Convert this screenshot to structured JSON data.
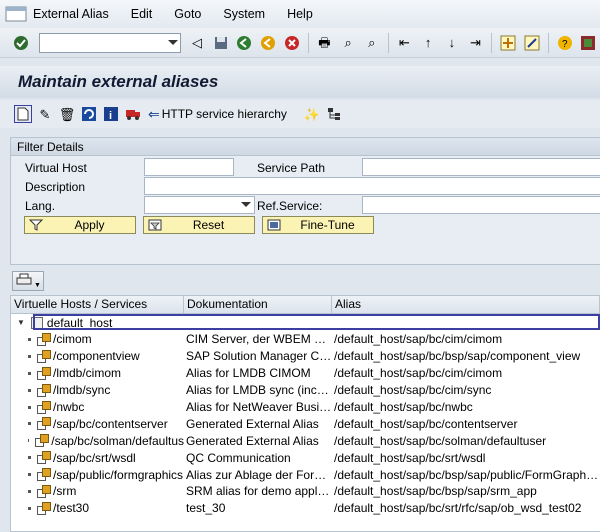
{
  "menu": {
    "items": [
      {
        "label": "External Alias"
      },
      {
        "label": "Edit"
      },
      {
        "label": "Goto"
      },
      {
        "label": "System"
      },
      {
        "label": "Help"
      }
    ]
  },
  "toolbar": {
    "command_value": ""
  },
  "page": {
    "title": "Maintain external aliases"
  },
  "app_toolbar": {
    "http_label": "HTTP service hierarchy"
  },
  "filter": {
    "title": "Filter Details",
    "virtual_host_label": "Virtual Host",
    "service_path_label": "Service Path",
    "description_label": "Description",
    "lang_label": "Lang.",
    "ref_service_label": "Ref.Service:",
    "apply_label": "Apply",
    "reset_label": "Reset",
    "fine_tune_label": "Fine-Tune"
  },
  "tree": {
    "headers": [
      "Virtuelle Hosts / Services",
      "Dokumentation",
      "Alias"
    ],
    "root": "default_host",
    "rows": [
      {
        "service": "/cimom",
        "doc": "CIM Server, der WBEM Re...",
        "alias": "/default_host/sap/bc/cim/cimom"
      },
      {
        "service": "/componentview",
        "doc": "SAP Solution Manager Co...",
        "alias": "/default_host/sap/bc/bsp/sap/component_view"
      },
      {
        "service": "/lmdb/cimom",
        "doc": "Alias for LMDB CIMOM",
        "alias": "/default_host/sap/bc/cim/cimom"
      },
      {
        "service": "/lmdb/sync",
        "doc": "Alias for LMDB sync (inco...",
        "alias": "/default_host/sap/bc/cim/sync"
      },
      {
        "service": "/nwbc",
        "doc": "Alias for NetWeaver Busine...",
        "alias": "/default_host/sap/bc/nwbc"
      },
      {
        "service": "/sap/bc/contentserver",
        "doc": "Generated External Alias",
        "alias": "/default_host/sap/bc/contentserver"
      },
      {
        "service": "/sap/bc/solman/defaultus",
        "doc": "Generated External Alias",
        "alias": "/default_host/sap/bc/solman/defaultuser"
      },
      {
        "service": "/sap/bc/srt/wsdl",
        "doc": "QC Communication",
        "alias": "/default_host/sap/bc/srt/wsdl"
      },
      {
        "service": "/sap/public/formgraphics",
        "doc": "Alias zur Ablage der Form...",
        "alias": "/default_host/sap/bc/bsp/sap/public/FormGraphics"
      },
      {
        "service": "/srm",
        "doc": "SRM alias for demo applica...",
        "alias": "/default_host/sap/bc/bsp/sap/srm_app"
      },
      {
        "service": "/test30",
        "doc": "test_30",
        "alias": "/default_host/sap/bc/srt/rfc/sap/ob_wsd_test02"
      }
    ]
  }
}
